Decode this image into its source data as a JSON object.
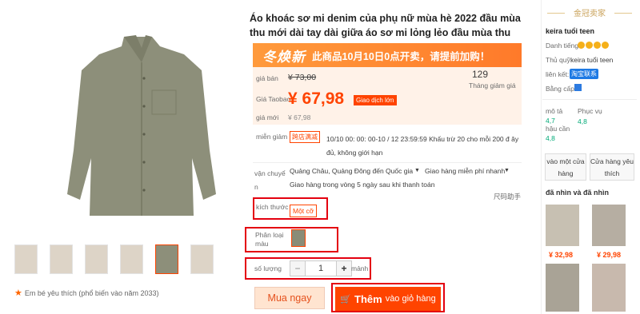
{
  "product": {
    "title": "Áo khoác sơ mi denim của phụ nữ mùa hè 2022 đầu mùa thu mới dài tay dài giữa áo sơ mi lỏng lẻo đầu mùa thu",
    "favorite_text": "Em bé yêu thích (phổ biến vào năm 2033)"
  },
  "promo": {
    "big": "冬焕新",
    "text": "此商品10月10日0点开卖，请提前加购！"
  },
  "price": {
    "orig_label": "giá bán",
    "orig_value": "¥ 73,00",
    "sold_count": "129",
    "sold_label": "Tháng giảm giá",
    "tb_label": "Giá Taobao",
    "tb_value": "¥ 67,98",
    "tb_badge": "Giao dịch lớn",
    "new_label": "giá mới",
    "new_value": "¥ 67,98"
  },
  "discount": {
    "label": "miễn giảm",
    "badge": "跨店满减",
    "text": "10/10 00: 00: 00-10 / 12 23:59:59 Khấu trừ 20 cho mỗi 200 đ ây đủ, không giới hạn"
  },
  "shipping": {
    "label": "vận chuyể n",
    "origin": "Quảng Châu, Quảng Đông đến Quốc gia",
    "free": "Giao hàng miễn phí nhanh",
    "delivery": "Giao hàng trong vòng 5 ngày sau khi thanh toán",
    "size_chart": "尺码助手"
  },
  "size": {
    "label": "kích thước",
    "option": "Một cỡ"
  },
  "color": {
    "label": "Phân loại màu"
  },
  "qty": {
    "label": "số lượng",
    "value": "1",
    "unit": "mảnh",
    "minus": "−",
    "plus": "+"
  },
  "actions": {
    "buy": "Mua ngay",
    "cart_a": "Thêm",
    "cart_b": "vào giỏ hàng"
  },
  "seller": {
    "head": "金冠卖家",
    "name": "keira tuổi teen",
    "rep_label": "Danh tiếng:",
    "owner_label": "Thủ quỹ:",
    "owner": "keira tuổi teen",
    "link_label": "liên kết:",
    "link_badge": "淘宝联系",
    "cert_label": "Bằng cấp:",
    "desc_label": "mô tả",
    "desc_score": "4,7",
    "service_label": "Phục vụ",
    "service_score": "4,8",
    "logistics_label": "hậu cần",
    "logistics_score": "4,8",
    "btn_store": "vào một cửa hàng",
    "btn_fav": "Cửa hàng yêu thích"
  },
  "seen": {
    "title": "đã nhìn và đã nhìn",
    "items": [
      {
        "price": "¥ 32,98"
      },
      {
        "price": "¥ 29,98"
      }
    ]
  }
}
